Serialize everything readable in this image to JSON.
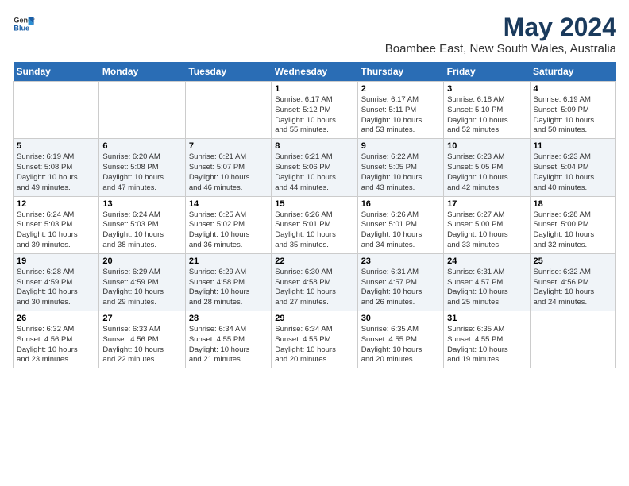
{
  "header": {
    "logo_general": "General",
    "logo_blue": "Blue",
    "title": "May 2024",
    "subtitle": "Boambee East, New South Wales, Australia"
  },
  "days_of_week": [
    "Sunday",
    "Monday",
    "Tuesday",
    "Wednesday",
    "Thursday",
    "Friday",
    "Saturday"
  ],
  "weeks": [
    {
      "days": [
        {
          "number": "",
          "info": ""
        },
        {
          "number": "",
          "info": ""
        },
        {
          "number": "",
          "info": ""
        },
        {
          "number": "1",
          "info": "Sunrise: 6:17 AM\nSunset: 5:12 PM\nDaylight: 10 hours\nand 55 minutes."
        },
        {
          "number": "2",
          "info": "Sunrise: 6:17 AM\nSunset: 5:11 PM\nDaylight: 10 hours\nand 53 minutes."
        },
        {
          "number": "3",
          "info": "Sunrise: 6:18 AM\nSunset: 5:10 PM\nDaylight: 10 hours\nand 52 minutes."
        },
        {
          "number": "4",
          "info": "Sunrise: 6:19 AM\nSunset: 5:09 PM\nDaylight: 10 hours\nand 50 minutes."
        }
      ]
    },
    {
      "days": [
        {
          "number": "5",
          "info": "Sunrise: 6:19 AM\nSunset: 5:08 PM\nDaylight: 10 hours\nand 49 minutes."
        },
        {
          "number": "6",
          "info": "Sunrise: 6:20 AM\nSunset: 5:08 PM\nDaylight: 10 hours\nand 47 minutes."
        },
        {
          "number": "7",
          "info": "Sunrise: 6:21 AM\nSunset: 5:07 PM\nDaylight: 10 hours\nand 46 minutes."
        },
        {
          "number": "8",
          "info": "Sunrise: 6:21 AM\nSunset: 5:06 PM\nDaylight: 10 hours\nand 44 minutes."
        },
        {
          "number": "9",
          "info": "Sunrise: 6:22 AM\nSunset: 5:05 PM\nDaylight: 10 hours\nand 43 minutes."
        },
        {
          "number": "10",
          "info": "Sunrise: 6:23 AM\nSunset: 5:05 PM\nDaylight: 10 hours\nand 42 minutes."
        },
        {
          "number": "11",
          "info": "Sunrise: 6:23 AM\nSunset: 5:04 PM\nDaylight: 10 hours\nand 40 minutes."
        }
      ]
    },
    {
      "days": [
        {
          "number": "12",
          "info": "Sunrise: 6:24 AM\nSunset: 5:03 PM\nDaylight: 10 hours\nand 39 minutes."
        },
        {
          "number": "13",
          "info": "Sunrise: 6:24 AM\nSunset: 5:03 PM\nDaylight: 10 hours\nand 38 minutes."
        },
        {
          "number": "14",
          "info": "Sunrise: 6:25 AM\nSunset: 5:02 PM\nDaylight: 10 hours\nand 36 minutes."
        },
        {
          "number": "15",
          "info": "Sunrise: 6:26 AM\nSunset: 5:01 PM\nDaylight: 10 hours\nand 35 minutes."
        },
        {
          "number": "16",
          "info": "Sunrise: 6:26 AM\nSunset: 5:01 PM\nDaylight: 10 hours\nand 34 minutes."
        },
        {
          "number": "17",
          "info": "Sunrise: 6:27 AM\nSunset: 5:00 PM\nDaylight: 10 hours\nand 33 minutes."
        },
        {
          "number": "18",
          "info": "Sunrise: 6:28 AM\nSunset: 5:00 PM\nDaylight: 10 hours\nand 32 minutes."
        }
      ]
    },
    {
      "days": [
        {
          "number": "19",
          "info": "Sunrise: 6:28 AM\nSunset: 4:59 PM\nDaylight: 10 hours\nand 30 minutes."
        },
        {
          "number": "20",
          "info": "Sunrise: 6:29 AM\nSunset: 4:59 PM\nDaylight: 10 hours\nand 29 minutes."
        },
        {
          "number": "21",
          "info": "Sunrise: 6:29 AM\nSunset: 4:58 PM\nDaylight: 10 hours\nand 28 minutes."
        },
        {
          "number": "22",
          "info": "Sunrise: 6:30 AM\nSunset: 4:58 PM\nDaylight: 10 hours\nand 27 minutes."
        },
        {
          "number": "23",
          "info": "Sunrise: 6:31 AM\nSunset: 4:57 PM\nDaylight: 10 hours\nand 26 minutes."
        },
        {
          "number": "24",
          "info": "Sunrise: 6:31 AM\nSunset: 4:57 PM\nDaylight: 10 hours\nand 25 minutes."
        },
        {
          "number": "25",
          "info": "Sunrise: 6:32 AM\nSunset: 4:56 PM\nDaylight: 10 hours\nand 24 minutes."
        }
      ]
    },
    {
      "days": [
        {
          "number": "26",
          "info": "Sunrise: 6:32 AM\nSunset: 4:56 PM\nDaylight: 10 hours\nand 23 minutes."
        },
        {
          "number": "27",
          "info": "Sunrise: 6:33 AM\nSunset: 4:56 PM\nDaylight: 10 hours\nand 22 minutes."
        },
        {
          "number": "28",
          "info": "Sunrise: 6:34 AM\nSunset: 4:55 PM\nDaylight: 10 hours\nand 21 minutes."
        },
        {
          "number": "29",
          "info": "Sunrise: 6:34 AM\nSunset: 4:55 PM\nDaylight: 10 hours\nand 20 minutes."
        },
        {
          "number": "30",
          "info": "Sunrise: 6:35 AM\nSunset: 4:55 PM\nDaylight: 10 hours\nand 20 minutes."
        },
        {
          "number": "31",
          "info": "Sunrise: 6:35 AM\nSunset: 4:55 PM\nDaylight: 10 hours\nand 19 minutes."
        },
        {
          "number": "",
          "info": ""
        }
      ]
    }
  ]
}
